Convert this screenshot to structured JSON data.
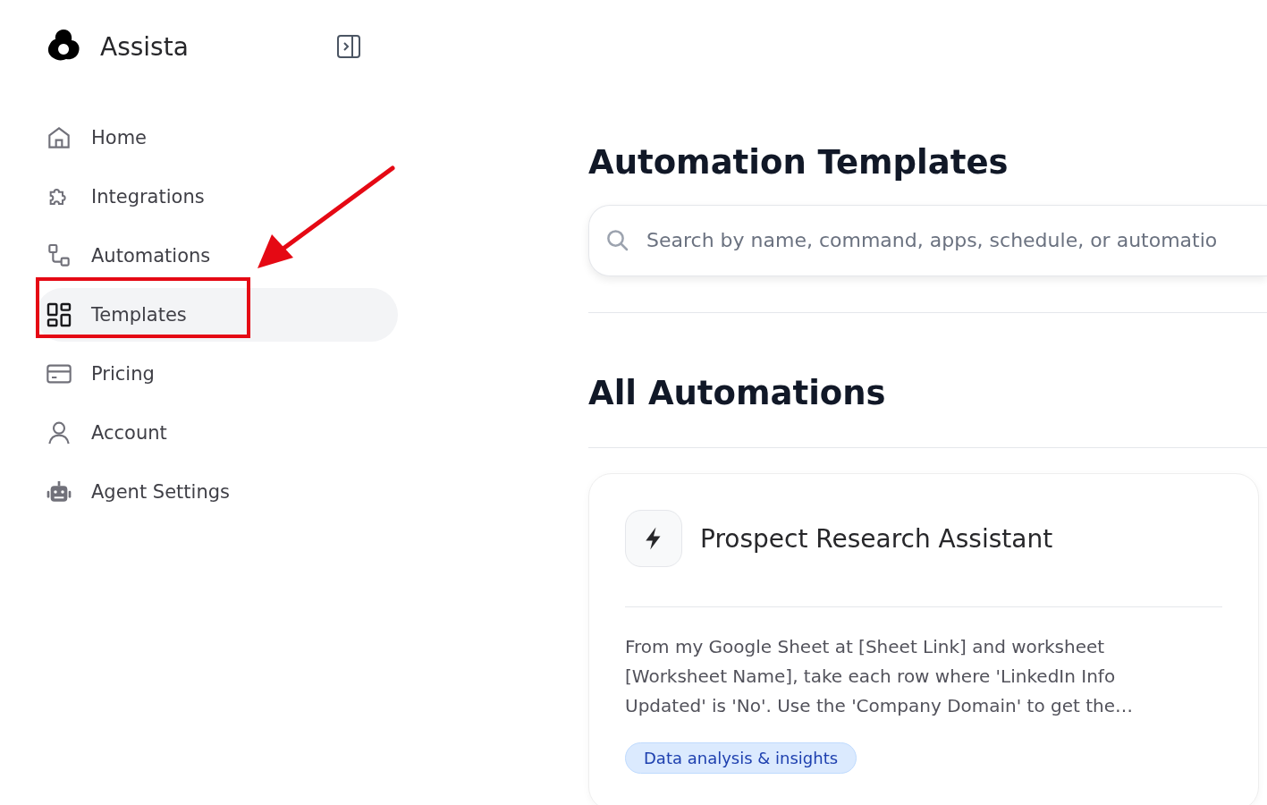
{
  "sidebar": {
    "brand": "Assista",
    "items": [
      {
        "label": "Home",
        "selected": false
      },
      {
        "label": "Integrations",
        "selected": false
      },
      {
        "label": "Automations",
        "selected": false
      },
      {
        "label": "Templates",
        "selected": true
      },
      {
        "label": "Pricing",
        "selected": false
      },
      {
        "label": "Account",
        "selected": false
      },
      {
        "label": "Agent Settings",
        "selected": false
      }
    ]
  },
  "main": {
    "title": "Automation Templates",
    "search": {
      "placeholder": "Search by name, command, apps, schedule, or automatio"
    },
    "section_title": "All Automations",
    "cards": [
      {
        "title": "Prospect Research Assistant",
        "description": "From my Google Sheet at [Sheet Link] and worksheet [Worksheet Name], take each row where 'LinkedIn Info Updated' is 'No'. Use the 'Company Domain' to get the…",
        "tags": [
          "Data analysis & insights"
        ]
      }
    ]
  }
}
